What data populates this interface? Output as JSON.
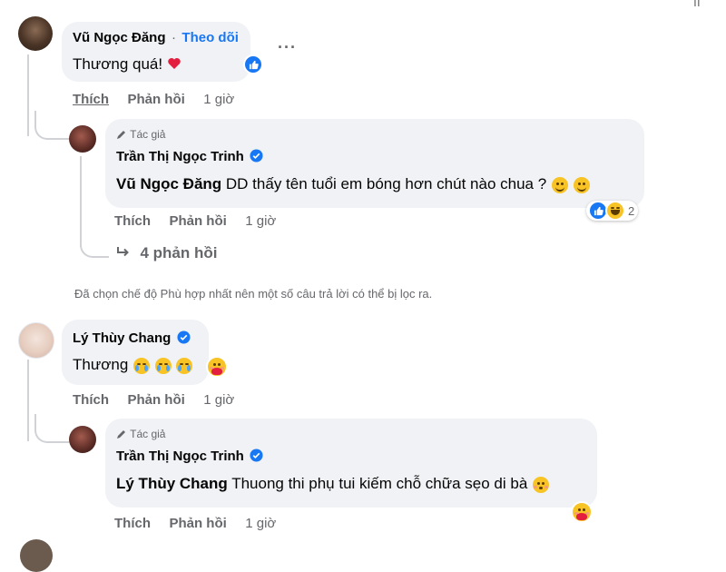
{
  "top_corner_glyph": "ıı",
  "more_icon_text": "···",
  "comment1": {
    "author": "Vũ Ngọc Đăng",
    "separator": "·",
    "follow": "Theo dõi",
    "text": "Thương quá!",
    "like": "Thích",
    "reply": "Phản hồi",
    "time": "1 giờ"
  },
  "reply1": {
    "author_tag": "Tác giả",
    "author": "Trần Thị Ngọc Trinh",
    "mention": "Vũ Ngọc Đăng",
    "text": "DD thấy tên tuổi em bóng hơn chút nào chua ?",
    "reaction_count": "2",
    "like": "Thích",
    "reply": "Phản hồi",
    "time": "1 giờ"
  },
  "more_replies": "4 phản hồi",
  "filter_notice": "Đã chọn chế độ Phù hợp nhất nên một số câu trả lời có thể bị lọc ra.",
  "comment2": {
    "author": "Lý Thùy Chang",
    "text": "Thương",
    "like": "Thích",
    "reply": "Phản hồi",
    "time": "1 giờ"
  },
  "reply2": {
    "author_tag": "Tác giả",
    "author": "Trần Thị Ngọc Trinh",
    "mention": "Lý Thùy Chang",
    "text": "Thuong thi phụ tui kiếm chỗ chữa sẹo di bà",
    "like": "Thích",
    "reply": "Phản hồi",
    "time": "1 giờ"
  },
  "colors": {
    "link_blue": "#1877f2",
    "bubble": "#f0f2f5",
    "meta_gray": "#65676b",
    "heart_red": "#e41e3f"
  }
}
